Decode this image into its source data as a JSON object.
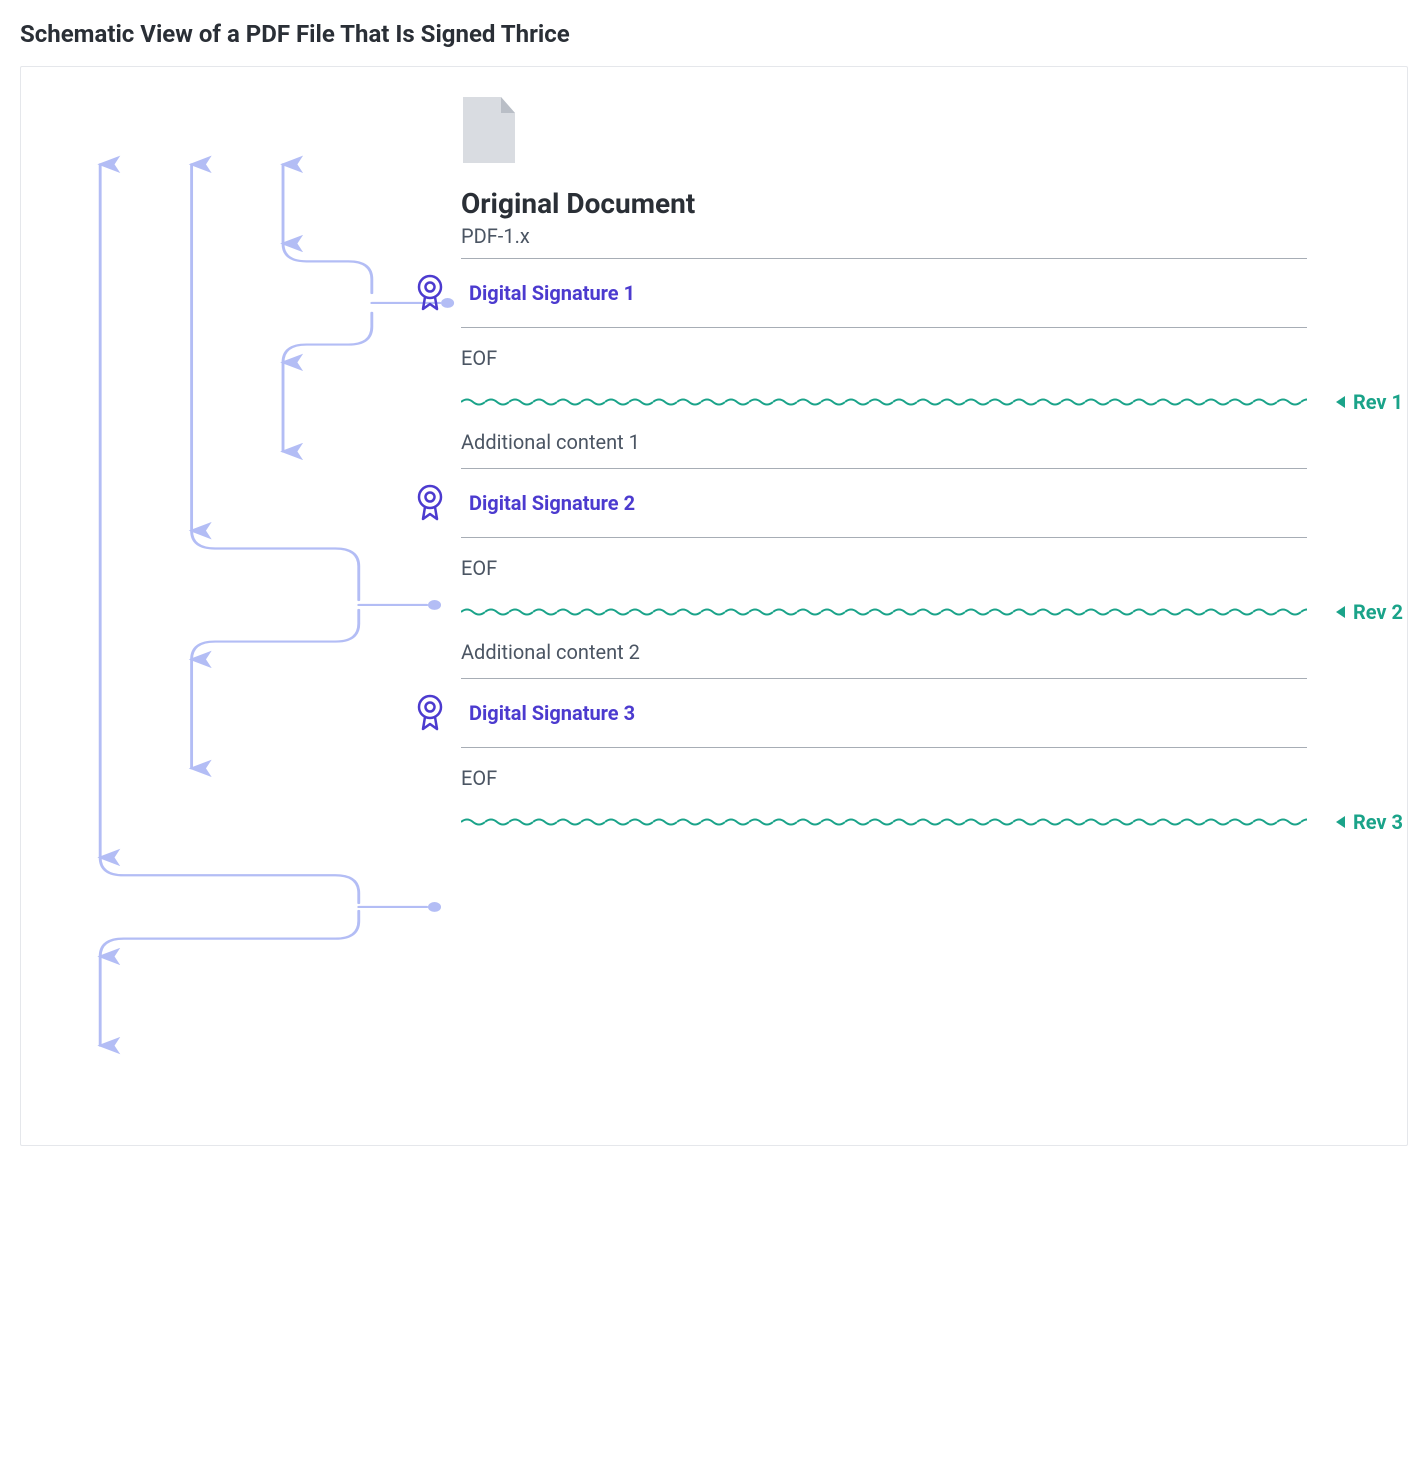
{
  "title": "Schematic View of a PDF File That Is Signed Thrice",
  "document": {
    "heading": "Original Document",
    "version": "PDF-1.x"
  },
  "rows": {
    "sig1": "Digital Signature 1",
    "eof1": "EOF",
    "rev1": "Rev 1",
    "add1": "Additional content 1",
    "sig2": "Digital Signature 2",
    "eof2": "EOF",
    "rev2": "Rev 2",
    "add2": "Additional content 2",
    "sig3": "Digital Signature 3",
    "eof3": "EOF",
    "rev3": "Rev 3"
  },
  "colors": {
    "bracket": "#b3bdf5",
    "sig": "#4c3bcf",
    "rev": "#1aa389",
    "rule": "#a7adb5",
    "text": "#4b5563",
    "heading": "#2a2f36"
  }
}
